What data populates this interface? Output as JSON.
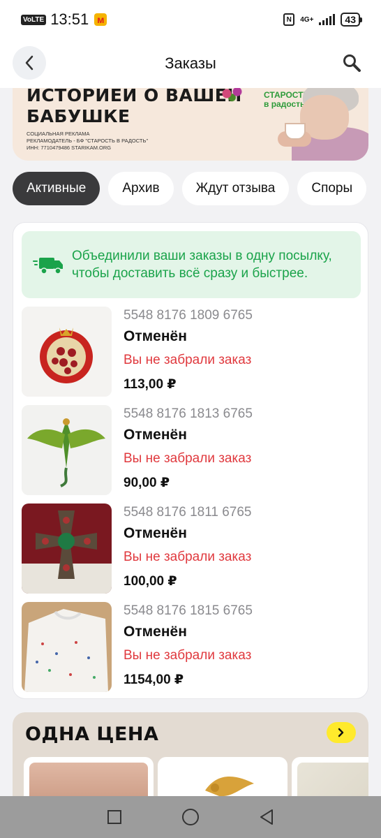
{
  "status_bar": {
    "volte": "VoLTE",
    "time": "13:51",
    "nfc": "N",
    "network": "4G+",
    "battery": "43"
  },
  "header": {
    "title": "Заказы"
  },
  "banner": {
    "headline_line1": "ИСТОРИЕЙ О ВАШЕЙ",
    "headline_line2": "БАБУШКЕ",
    "small_line1": "СОЦИАЛЬНАЯ РЕКЛАМА",
    "small_line2": "РЕКЛАМОДАТЕЛЬ - БФ \"СТАРОСТЬ В РАДОСТЬ\"",
    "small_line3": "ИНН: 7710479486  STARIKAM.ORG",
    "logo_line1": "СТАРОСТЬ",
    "logo_line2": "в радость"
  },
  "tabs": [
    {
      "label": "Активные",
      "active": true
    },
    {
      "label": "Архив",
      "active": false
    },
    {
      "label": "Ждут отзыва",
      "active": false
    },
    {
      "label": "Споры",
      "active": false
    }
  ],
  "merge_note": {
    "text": "Объединили ваши заказы в одну посылку, чтобы доставить всё сразу и быстрее."
  },
  "orders": [
    {
      "number": "5548 8176 1809 6765",
      "status": "Отменён",
      "reason": "Вы не забрали заказ",
      "price": "113,00 ₽",
      "image": "pomegranate-brooch"
    },
    {
      "number": "5548 8176 1813 6765",
      "status": "Отменён",
      "reason": "Вы не забрали заказ",
      "price": "90,00 ₽",
      "image": "dragon-brooch"
    },
    {
      "number": "5548 8176 1811 6765",
      "status": "Отменён",
      "reason": "Вы не забрали заказ",
      "price": "100,00 ₽",
      "image": "cross-brooch"
    },
    {
      "number": "5548 8176 1815 6765",
      "status": "Отменён",
      "reason": "Вы не забрали заказ",
      "price": "1154,00 ₽",
      "image": "floral-blouse"
    }
  ],
  "one_price": {
    "title": "ОДНА ЦЕНА",
    "button_icon": "chevron-right-icon"
  },
  "colors": {
    "active_tab": "#3a3a3c",
    "note_bg": "#e3f5e8",
    "note_text": "#1aa34a",
    "cancel_reason": "#e0393e",
    "one_price_bg": "#e3dbd2",
    "one_price_button": "#ffea2c"
  }
}
